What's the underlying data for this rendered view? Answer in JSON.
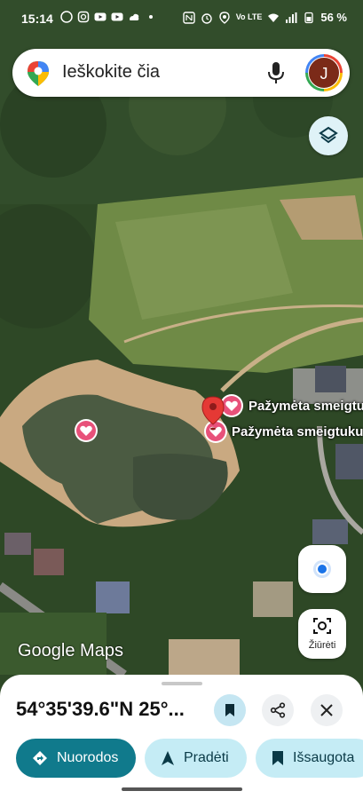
{
  "status_bar": {
    "time": "15:14",
    "battery": "56 %",
    "network": "Vo LTE"
  },
  "search": {
    "placeholder": "Ieškokite čia",
    "avatar_letter": "J"
  },
  "map": {
    "pins": [
      {
        "label": "Pažymėta smeigtu"
      },
      {
        "label": "Pažymėta smeigtuku"
      }
    ],
    "lens_label": "Žiūrėti",
    "attribution": "Google Maps"
  },
  "sheet": {
    "coords": "54°35'39.6\"N 25°...",
    "actions": {
      "directions": "Nuorodos",
      "start": "Pradėti",
      "saved": "Išsaugota"
    }
  },
  "colors": {
    "primary": "#107a8c",
    "chip": "#c5ecf5",
    "pin_red": "#e53935",
    "heart": "#e8517a"
  }
}
